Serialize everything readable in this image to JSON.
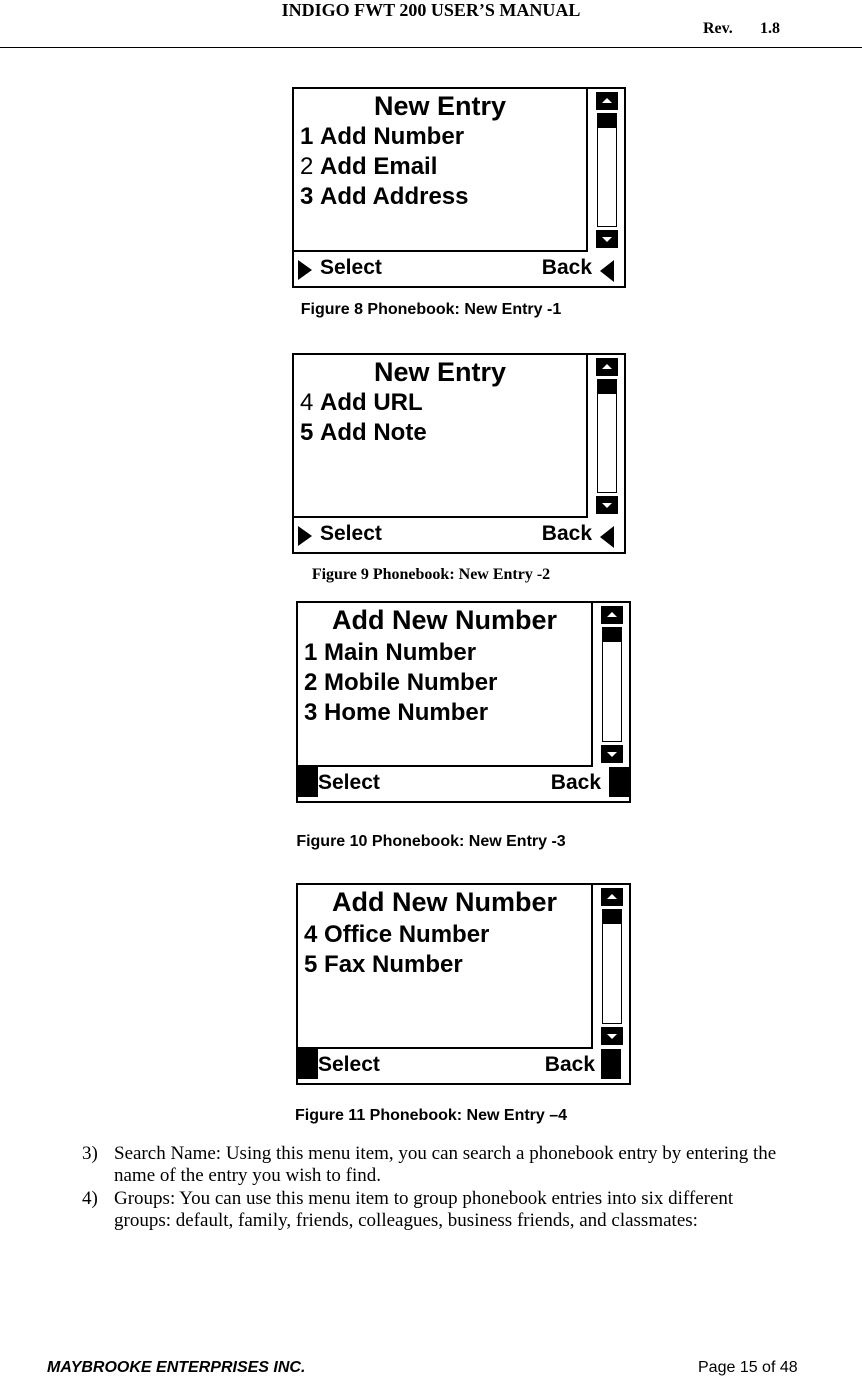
{
  "header": {
    "title": "INDIGO FWT 200 USER’S MANUAL",
    "rev_label": "Rev.",
    "rev_number": "1.8"
  },
  "figures": [
    {
      "screen_title": "New Entry",
      "items": [
        {
          "num": "1",
          "label": "Add Number",
          "num_bold": true
        },
        {
          "num": "2",
          "label": "Add Email",
          "num_bold": false
        },
        {
          "num": "3",
          "label": "Add Address",
          "num_bold": true
        }
      ],
      "softkeys": {
        "left": "Select",
        "right": "Back"
      },
      "caption": "Figure 8 Phonebook: New Entry -1"
    },
    {
      "screen_title": "New Entry",
      "items": [
        {
          "num": "4",
          "label": "Add URL",
          "num_bold": false
        },
        {
          "num": "5",
          "label": "Add Note",
          "num_bold": true
        }
      ],
      "softkeys": {
        "left": "Select",
        "right": "Back"
      },
      "caption": "Figure 9  Phonebook: New Entry -2"
    },
    {
      "screen_title": "Add New Number",
      "items": [
        {
          "num": "1",
          "label": "Main Number",
          "num_bold": true
        },
        {
          "num": "2",
          "label": "Mobile Number",
          "num_bold": true
        },
        {
          "num": "3",
          "label": "Home Number",
          "num_bold": true
        }
      ],
      "softkeys": {
        "left": "Select",
        "right": "Back"
      },
      "caption": "Figure 10  Phonebook: New Entry -3"
    },
    {
      "screen_title": "Add New Number",
      "items": [
        {
          "num": "4",
          "label": "Office Number",
          "num_bold": true
        },
        {
          "num": "5",
          "label": "Fax Number",
          "num_bold": true
        }
      ],
      "softkeys": {
        "left": "Select",
        "right": "Back"
      },
      "caption": "Figure 11 Phonebook: New Entry –4"
    }
  ],
  "body_list": [
    {
      "num": "3)",
      "text": "Search Name: Using this menu item, you can search a phonebook entry by entering the name of the entry you wish to find."
    },
    {
      "num": "4)",
      "text": "Groups:  You can use this menu item to group phonebook entries into six different groups: default, family, friends, colleagues, business friends, and classmates:"
    }
  ],
  "footer": {
    "company": "MAYBROOKE ENTERPRISES INC.",
    "page": "Page 15 of 48"
  }
}
